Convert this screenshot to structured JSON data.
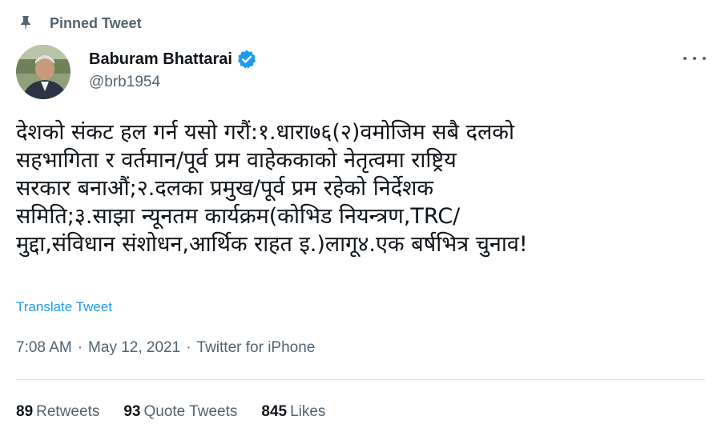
{
  "pinned": {
    "label": "Pinned Tweet",
    "icon": "pin-icon"
  },
  "author": {
    "name": "Baburam Bhattarai",
    "handle": "@brb1954",
    "verified": true,
    "verified_color": "#1d9bf0"
  },
  "tweet": {
    "lines": [
      "देशको संकट हल गर्न यसो गरौं:१.धारा७६(२)वमोजिम सबै दलको",
      "सहभागिता र वर्तमान/पूर्व प्रम वाहेककाको नेतृत्वमा राष्ट्रिय",
      "सरकार बनाऔं;२.दलका प्रमुख/पूर्व प्रम रहेको निर्देशक",
      "समिति;३.साझा न्यूनतम कार्यक्रम(कोभिड नियन्त्रण,TRC/",
      "मुद्दा,संविधान संशोधन,आर्थिक राहत इ.)लागू४.एक बर्षभित्र चुनाव!"
    ],
    "translate_label": "Translate Tweet"
  },
  "meta": {
    "time": "7:08 AM",
    "separator": "·",
    "date": "May 12, 2021",
    "source": "Twitter for iPhone"
  },
  "stats": {
    "retweets_count": "89",
    "retweets_label": "Retweets",
    "quotes_count": "93",
    "quotes_label": "Quote Tweets",
    "likes_count": "845",
    "likes_label": "Likes"
  },
  "colors": {
    "text_primary": "#0f1419",
    "text_secondary": "#536471",
    "link": "#1d9bf0",
    "divider": "#dfe3e6"
  }
}
